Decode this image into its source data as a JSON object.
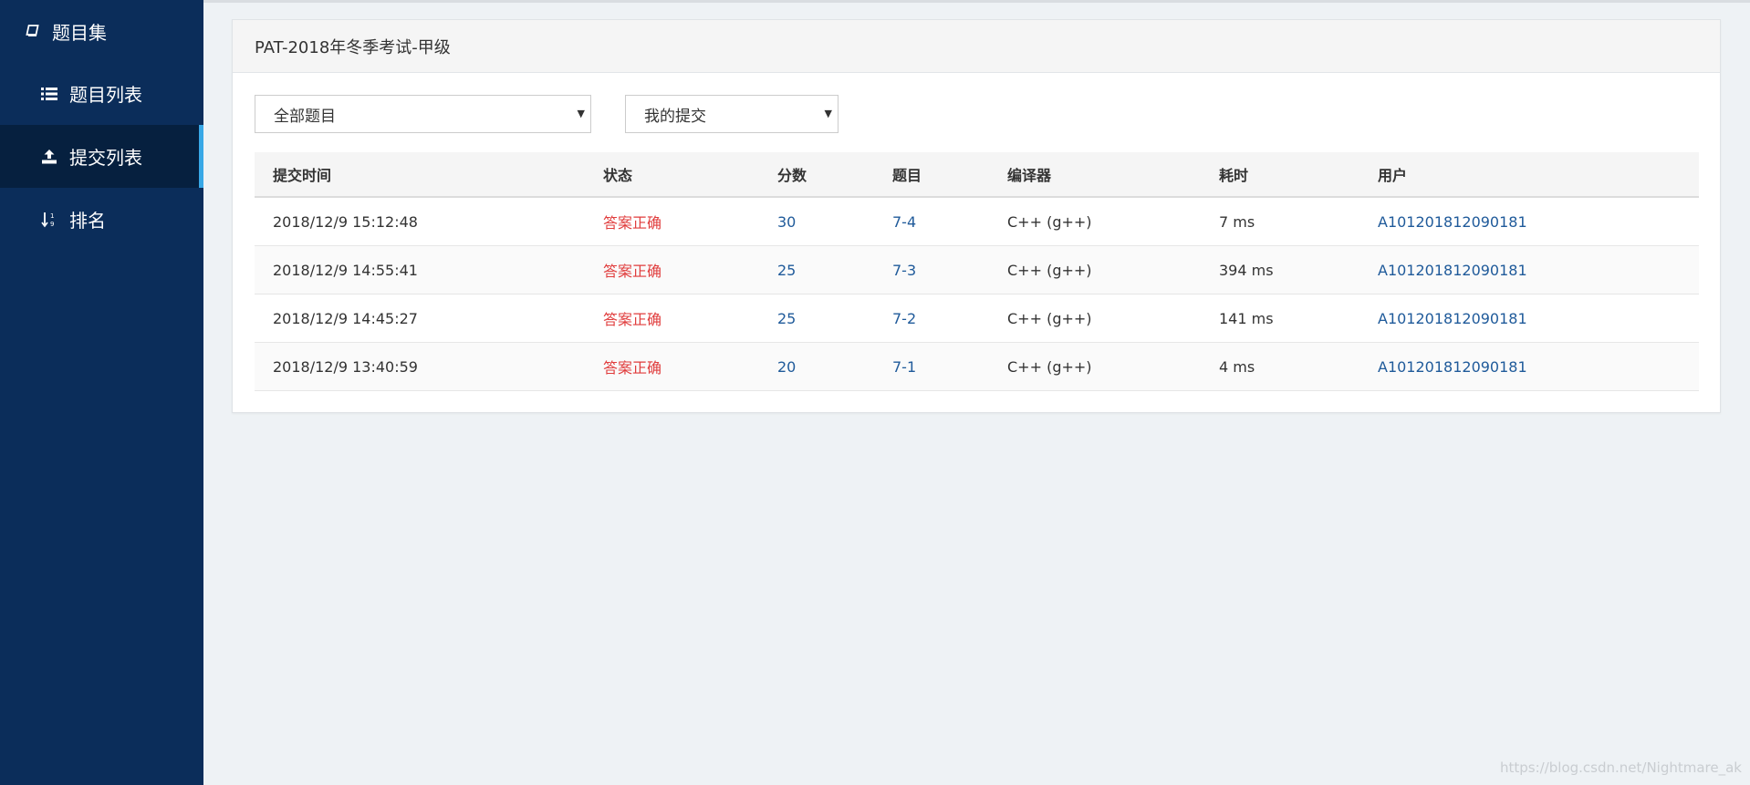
{
  "sidebar": {
    "title": "题目集",
    "items": [
      {
        "label": "题目列表",
        "icon": "list-icon",
        "active": false
      },
      {
        "label": "提交列表",
        "icon": "upload-icon",
        "active": true
      },
      {
        "label": "排名",
        "icon": "sort-numeric-icon",
        "active": false
      }
    ]
  },
  "panel": {
    "title": "PAT-2018年冬季考试-甲级",
    "filters": {
      "problem_select": "全部题目",
      "submission_select": "我的提交"
    }
  },
  "table": {
    "headers": [
      "提交时间",
      "状态",
      "分数",
      "题目",
      "编译器",
      "耗时",
      "用户"
    ],
    "rows": [
      {
        "time": "2018/12/9 15:12:48",
        "status": "答案正确",
        "score": "30",
        "problem": "7-4",
        "compiler": "C++ (g++)",
        "duration": "7 ms",
        "user": "A101201812090181"
      },
      {
        "time": "2018/12/9 14:55:41",
        "status": "答案正确",
        "score": "25",
        "problem": "7-3",
        "compiler": "C++ (g++)",
        "duration": "394 ms",
        "user": "A101201812090181"
      },
      {
        "time": "2018/12/9 14:45:27",
        "status": "答案正确",
        "score": "25",
        "problem": "7-2",
        "compiler": "C++ (g++)",
        "duration": "141 ms",
        "user": "A101201812090181"
      },
      {
        "time": "2018/12/9 13:40:59",
        "status": "答案正确",
        "score": "20",
        "problem": "7-1",
        "compiler": "C++ (g++)",
        "duration": "4 ms",
        "user": "A101201812090181"
      }
    ]
  },
  "watermark": "https://blog.csdn.net/Nightmare_ak",
  "colors": {
    "sidebar_bg": "#0b2d5a",
    "sidebar_active_bg": "#06203f",
    "active_accent": "#38a8e6",
    "status_ok": "#e03c3c",
    "link": "#1f5a9a"
  }
}
